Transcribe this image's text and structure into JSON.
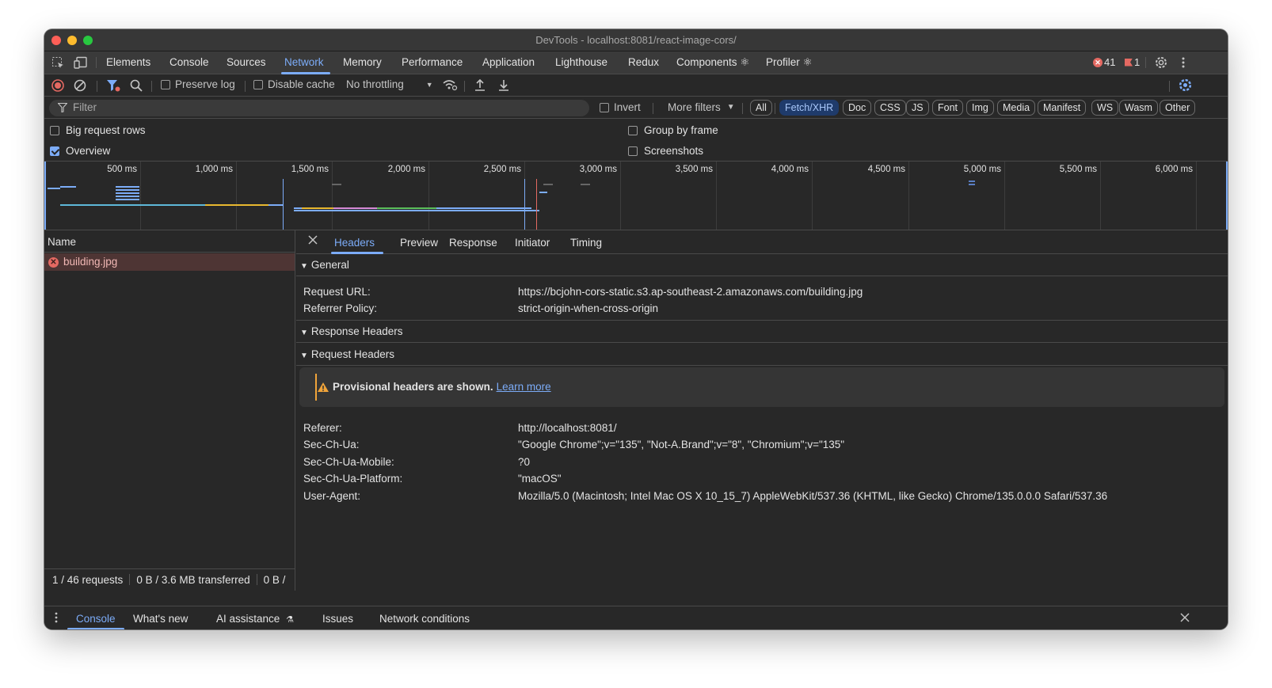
{
  "window": {
    "title": "DevTools - localhost:8081/react-image-cors/"
  },
  "panel_tabs": [
    {
      "label": "Elements"
    },
    {
      "label": "Console"
    },
    {
      "label": "Sources"
    },
    {
      "label": "Network"
    },
    {
      "label": "Memory"
    },
    {
      "label": "Performance"
    },
    {
      "label": "Application"
    },
    {
      "label": "Lighthouse"
    },
    {
      "label": "Redux"
    },
    {
      "label": "Components ⚛"
    },
    {
      "label": "Profiler ⚛"
    }
  ],
  "active_panel": "Network",
  "badges": {
    "errors": "41",
    "issues": "1"
  },
  "toolbar": {
    "preserve_log": "Preserve log",
    "disable_cache": "Disable cache",
    "throttling": "No throttling"
  },
  "filter": {
    "placeholder": "Filter",
    "invert": "Invert",
    "more_filters": "More filters"
  },
  "type_filters": [
    {
      "label": "All"
    },
    {
      "label": "Fetch/XHR",
      "active": true
    },
    {
      "label": "Doc"
    },
    {
      "label": "CSS"
    },
    {
      "label": "JS"
    },
    {
      "label": "Font"
    },
    {
      "label": "Img"
    },
    {
      "label": "Media"
    },
    {
      "label": "Manifest"
    },
    {
      "label": "WS"
    },
    {
      "label": "Wasm"
    },
    {
      "label": "Other"
    }
  ],
  "options": {
    "big_request_rows": "Big request rows",
    "overview": "Overview",
    "group_by_frame": "Group by frame",
    "screenshots": "Screenshots",
    "overview_checked": true
  },
  "timeline": {
    "ticks": [
      "500 ms",
      "1,000 ms",
      "1,500 ms",
      "2,000 ms",
      "2,500 ms",
      "3,000 ms",
      "3,500 ms",
      "4,000 ms",
      "4,500 ms",
      "5,000 ms",
      "5,500 ms",
      "6,000 ms"
    ]
  },
  "requests": {
    "column_name": "Name",
    "rows": [
      {
        "name": "building.jpg",
        "status": "error"
      }
    ]
  },
  "status": {
    "requests": "1 / 46 requests",
    "transferred": "0 B / 3.6 MB transferred",
    "resources": "0 B /"
  },
  "detail_tabs": [
    {
      "label": "Headers"
    },
    {
      "label": "Preview"
    },
    {
      "label": "Response"
    },
    {
      "label": "Initiator"
    },
    {
      "label": "Timing"
    }
  ],
  "general": {
    "title": "General",
    "rows": [
      {
        "key": "Request URL:",
        "value": "https://bcjohn-cors-static.s3.ap-southeast-2.amazonaws.com/building.jpg"
      },
      {
        "key": "Referrer Policy:",
        "value": "strict-origin-when-cross-origin"
      }
    ]
  },
  "response_headers": {
    "title": "Response Headers"
  },
  "request_headers": {
    "title": "Request Headers",
    "warning": "Provisional headers are shown.",
    "learn_more": "Learn more",
    "rows": [
      {
        "key": "Referer:",
        "value": "http://localhost:8081/"
      },
      {
        "key": "Sec-Ch-Ua:",
        "value": "\"Google Chrome\";v=\"135\", \"Not-A.Brand\";v=\"8\", \"Chromium\";v=\"135\""
      },
      {
        "key": "Sec-Ch-Ua-Mobile:",
        "value": "?0"
      },
      {
        "key": "Sec-Ch-Ua-Platform:",
        "value": "\"macOS\""
      },
      {
        "key": "User-Agent:",
        "value": "Mozilla/5.0 (Macintosh; Intel Mac OS X 10_15_7) AppleWebKit/537.36 (KHTML, like Gecko) Chrome/135.0.0.0 Safari/537.36"
      }
    ]
  },
  "drawer_tabs": [
    {
      "label": "Console"
    },
    {
      "label": "What's new"
    },
    {
      "label": "AI assistance"
    },
    {
      "label": "Issues"
    },
    {
      "label": "Network conditions"
    }
  ],
  "icons": {
    "close": "close-icon",
    "settings": "gear-icon",
    "more": "kebab-icon",
    "filter": "filter-icon",
    "search": "search-icon"
  }
}
